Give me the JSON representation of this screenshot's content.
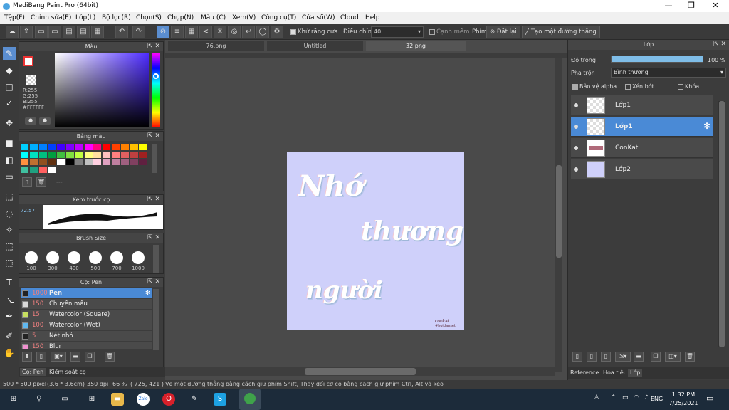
{
  "window": {
    "title": "MediBang Paint Pro (64bit)",
    "min": "—",
    "max": "❐",
    "close": "✕"
  },
  "menu": [
    "Tệp(F)",
    "Chỉnh sửa(E)",
    "Lớp(L)",
    "Bộ lọc(R)",
    "Chọn(S)",
    "Chụp(N)",
    "Màu (C)",
    "Xem(V)",
    "Công cụ(T)",
    "Cửa sổ(W)",
    "Cloud",
    "Help"
  ],
  "toolbar": {
    "antialias_label": "Khử răng cưa",
    "adjust_label": "Điều chỉnh",
    "adjust_value": "40",
    "smooth_label": "Cạnh mềm",
    "key_label": "Phím",
    "reset_label": "Đặt lại",
    "line_label": "Tạo một đường thẳng"
  },
  "panels": {
    "color": {
      "title": "Màu",
      "rgb": "R:255\nG:255\nB:255",
      "hex": "#FFFFFF"
    },
    "palette": {
      "title": "Bảng màu",
      "dots": "---"
    },
    "preview": {
      "title": "Xem trước cọ",
      "value": "72.57"
    },
    "brushsize": {
      "title": "Brush Size",
      "sizes": [
        "100",
        "300",
        "400",
        "500",
        "700",
        "1000"
      ]
    },
    "brushes": {
      "title": "Cọ: Pen",
      "items": [
        {
          "size": "1000",
          "name": "Pen",
          "color": "#222222"
        },
        {
          "size": "150",
          "name": "Chuyển mầu",
          "color": "#d8d8d8"
        },
        {
          "size": "15",
          "name": "Watercolor (Square)",
          "color": "#c8e060"
        },
        {
          "size": "100",
          "name": "Watercolor (Wet)",
          "color": "#60b8f0"
        },
        {
          "size": "5",
          "name": "Nét nhỏ",
          "color": "#222222"
        },
        {
          "size": "150",
          "name": "Blur",
          "color": "#f090d0"
        }
      ]
    },
    "bottom_tabs": [
      "Cọ: Pen",
      "Kiểm soát cọ"
    ]
  },
  "tabs": [
    "76.png",
    "Untitled",
    "32.png"
  ],
  "artwork": {
    "line1": "Nhớ",
    "line2": "thương",
    "line3": "người",
    "sig1": "conkat",
    "sig2": "#hoidapset"
  },
  "layers_panel": {
    "title": "Lớp",
    "opacity_label": "Độ trong",
    "opacity_value": "100 %",
    "blend_label": "Pha trộn",
    "blend_value": "Bình thường",
    "protect_alpha": "Bảo vệ alpha",
    "clip": "Xén bớt",
    "lock": "Khóa",
    "layers": [
      {
        "name": "Lớp1",
        "selected": false
      },
      {
        "name": "Lớp1",
        "selected": true
      },
      {
        "name": "ConKat",
        "selected": false
      },
      {
        "name": "Lớp2",
        "selected": false
      }
    ],
    "bottom_tabs": [
      "Reference",
      "Hoa tiêu",
      "Lớp"
    ]
  },
  "status": {
    "size": "500 * 500 pixel",
    "cm": "(3.6 * 3.6cm)",
    "dpi": "350 dpi",
    "zoom": "66 %",
    "coords": "( 725, 421 )",
    "hint": "Vẽ một đường thẳng bằng cách giữ phím Shift, Thay đổi cỡ cọ bằng cách giữ phím Ctrl, Alt và kéo"
  },
  "taskbar": {
    "lang": "ENG",
    "time": "1:32 PM",
    "date": "7/25/2021"
  }
}
